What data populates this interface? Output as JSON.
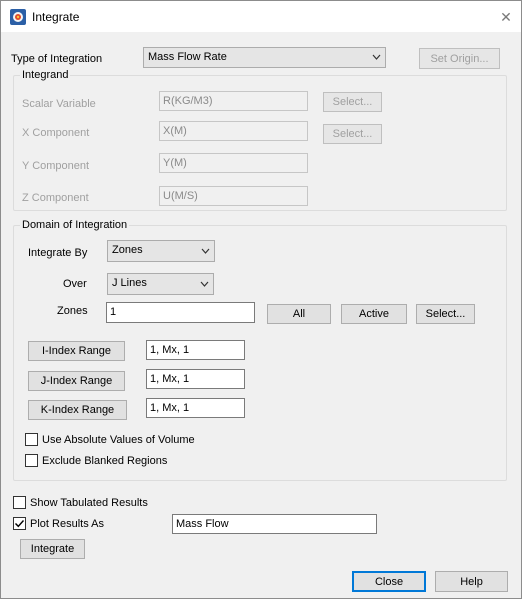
{
  "window": {
    "title": "Integrate",
    "close_glyph": "✕"
  },
  "type_of_integration": {
    "label": "Type of Integration",
    "selected": "Mass Flow Rate",
    "set_origin_label": "Set Origin..."
  },
  "integrand": {
    "title": "Integrand",
    "scalar": {
      "label": "Scalar Variable",
      "value": "R(KG/M3)",
      "select_label": "Select..."
    },
    "x": {
      "label": "X Component",
      "value": "X(M)",
      "select_label": "Select..."
    },
    "y": {
      "label": "Y Component",
      "value": "Y(M)"
    },
    "z": {
      "label": "Z Component",
      "value": "U(M/S)"
    }
  },
  "domain": {
    "title": "Domain of Integration",
    "integrate_by": {
      "label": "Integrate By",
      "selected": "Zones"
    },
    "over": {
      "label": "Over",
      "selected": "J Lines"
    },
    "zones": {
      "label": "Zones",
      "value": "1",
      "all_label": "All",
      "active_label": "Active",
      "select_label": "Select..."
    },
    "i_range": {
      "label": "I-Index Range",
      "value": "1, Mx, 1"
    },
    "j_range": {
      "label": "J-Index Range",
      "value": "1, Mx, 1"
    },
    "k_range": {
      "label": "K-Index Range",
      "value": "1, Mx, 1"
    },
    "abs_volume": {
      "label": "Use Absolute Values of Volume",
      "checked": false
    },
    "exclude_blanked": {
      "label": "Exclude Blanked Regions",
      "checked": false
    }
  },
  "show_tabulated": {
    "label": "Show Tabulated Results",
    "checked": false
  },
  "plot_results": {
    "label": "Plot Results As",
    "checked": true,
    "value": "Mass Flow"
  },
  "buttons": {
    "integrate": "Integrate",
    "close": "Close",
    "help": "Help"
  },
  "icons": {
    "app": "tecplot-app-icon",
    "chevron": "chevron-down-icon",
    "check": "checkmark-icon"
  },
  "colors": {
    "accent": "#0078d7",
    "disabled_text": "#a0a0a0"
  }
}
